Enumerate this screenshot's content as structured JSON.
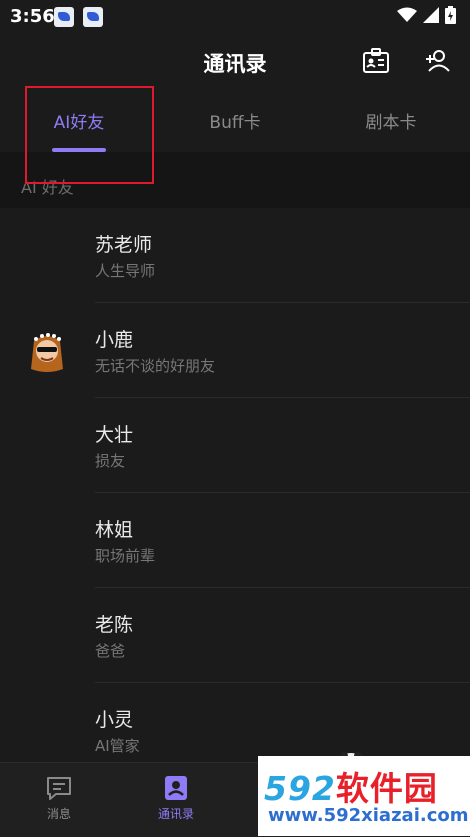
{
  "status_bar": {
    "time": "3:56"
  },
  "header": {
    "title": "通讯录"
  },
  "tabs": [
    {
      "label": "AI好友",
      "active": true
    },
    {
      "label": "Buff卡",
      "active": false
    },
    {
      "label": "剧本卡",
      "active": false
    }
  ],
  "section": {
    "label": "AI 好友"
  },
  "contacts": [
    {
      "name": "苏老师",
      "desc": "人生导师"
    },
    {
      "name": "小鹿",
      "desc": "无话不谈的好朋友"
    },
    {
      "name": "大壮",
      "desc": "损友"
    },
    {
      "name": "林姐",
      "desc": "职场前辈"
    },
    {
      "name": "老陈",
      "desc": "爸爸"
    },
    {
      "name": "小灵",
      "desc": "AI管家"
    }
  ],
  "bottom_nav": [
    {
      "label": "消息",
      "active": false
    },
    {
      "label": "通讯录",
      "active": true
    }
  ],
  "watermark": {
    "logo_num": "592",
    "logo_cn": "软件园",
    "url": "www.592xiazai.com"
  },
  "colors": {
    "accent": "#8f7bf5",
    "background": "#1b1b1b",
    "highlight_box": "#e0192c"
  }
}
